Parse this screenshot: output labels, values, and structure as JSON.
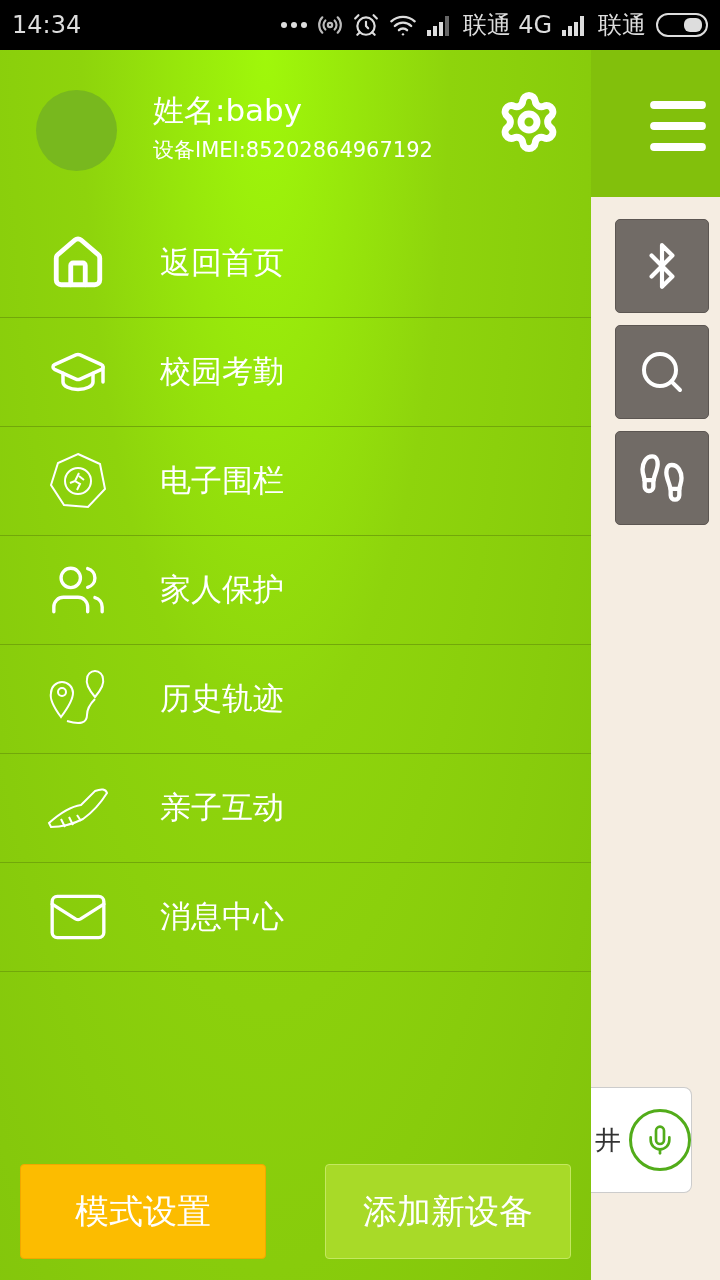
{
  "status_bar": {
    "time": "14:34",
    "carrier_1": "联通 4G",
    "carrier_2": "联通"
  },
  "profile": {
    "name": "姓名:baby",
    "imei": "设备IMEI:85202864967192"
  },
  "menu": [
    {
      "kind": "home",
      "label": "返回首页"
    },
    {
      "kind": "school",
      "label": "校园考勤"
    },
    {
      "kind": "fence",
      "label": "电子围栏"
    },
    {
      "kind": "family",
      "label": "家人保护"
    },
    {
      "kind": "history",
      "label": "历史轨迹"
    },
    {
      "kind": "shoe",
      "label": "亲子互动"
    },
    {
      "kind": "mail",
      "label": "消息中心"
    }
  ],
  "buttons": [
    {
      "kind": "primary",
      "label": "模式设置"
    },
    {
      "kind": "secondary",
      "label": "添加新设备"
    }
  ],
  "map_card": {
    "text": "井"
  }
}
